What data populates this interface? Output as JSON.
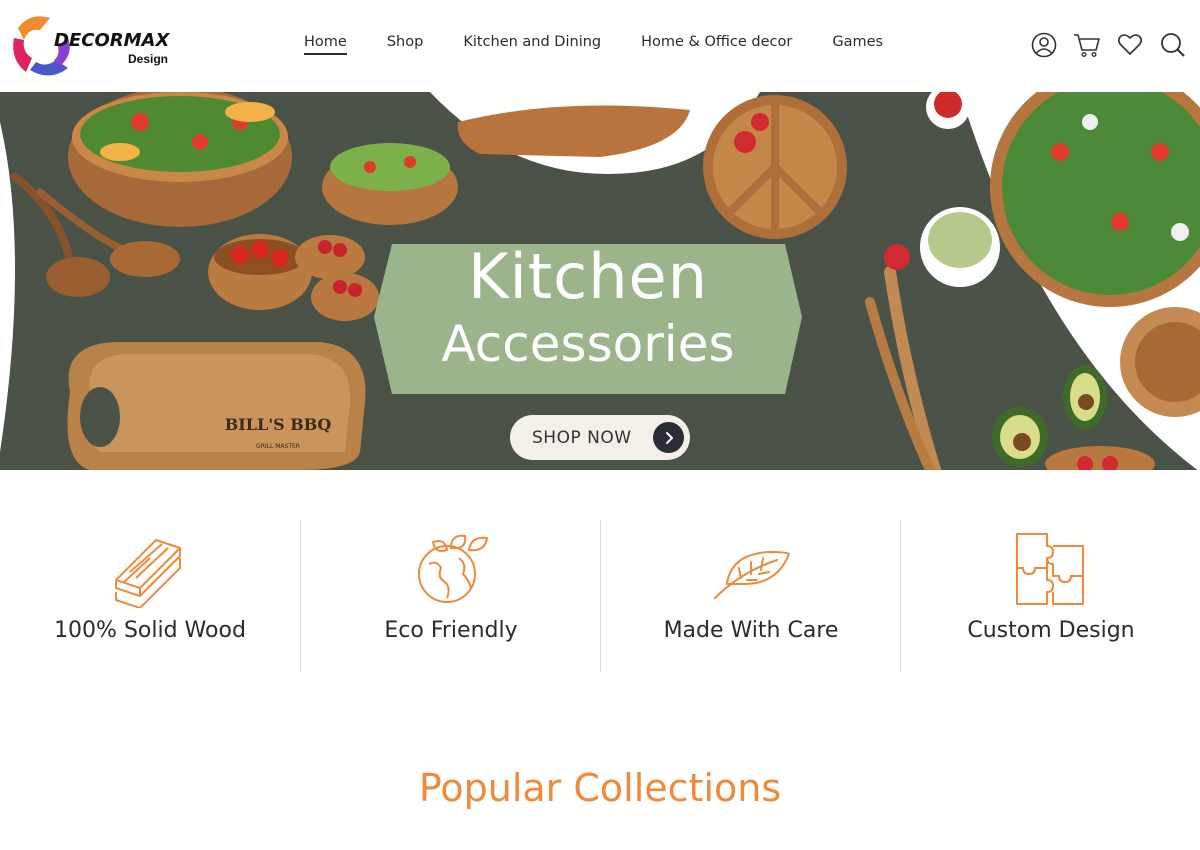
{
  "brand": {
    "logo_text": "DECORMAX",
    "logo_sub": "Design"
  },
  "nav": {
    "items": [
      {
        "label": "Home",
        "active": true
      },
      {
        "label": "Shop"
      },
      {
        "label": "Kitchen and Dining"
      },
      {
        "label": "Home & Office decor"
      },
      {
        "label": "Games"
      }
    ]
  },
  "header_icons": [
    "account-icon",
    "cart-icon",
    "wishlist-heart-icon",
    "search-icon"
  ],
  "hero": {
    "title": "Kitchen",
    "subtitle": "Accessories",
    "cta_label": "SHOP NOW",
    "board_engraving": "BILL'S BBQ",
    "board_engraving_sub": "GRILL MASTER"
  },
  "features": [
    {
      "label": "100% Solid Wood",
      "icon": "wood-planks-icon"
    },
    {
      "label": "Eco Friendly",
      "icon": "eco-globe-icon"
    },
    {
      "label": "Made With Care",
      "icon": "leaf-icon"
    },
    {
      "label": "Custom Design",
      "icon": "puzzle-icon"
    }
  ],
  "section_title": "Popular Collections",
  "colors": {
    "accent_orange": "#ef8a3c",
    "hero_bg": "#4b5349",
    "label_green": "#9bb48c",
    "wood": "#b57a45"
  }
}
